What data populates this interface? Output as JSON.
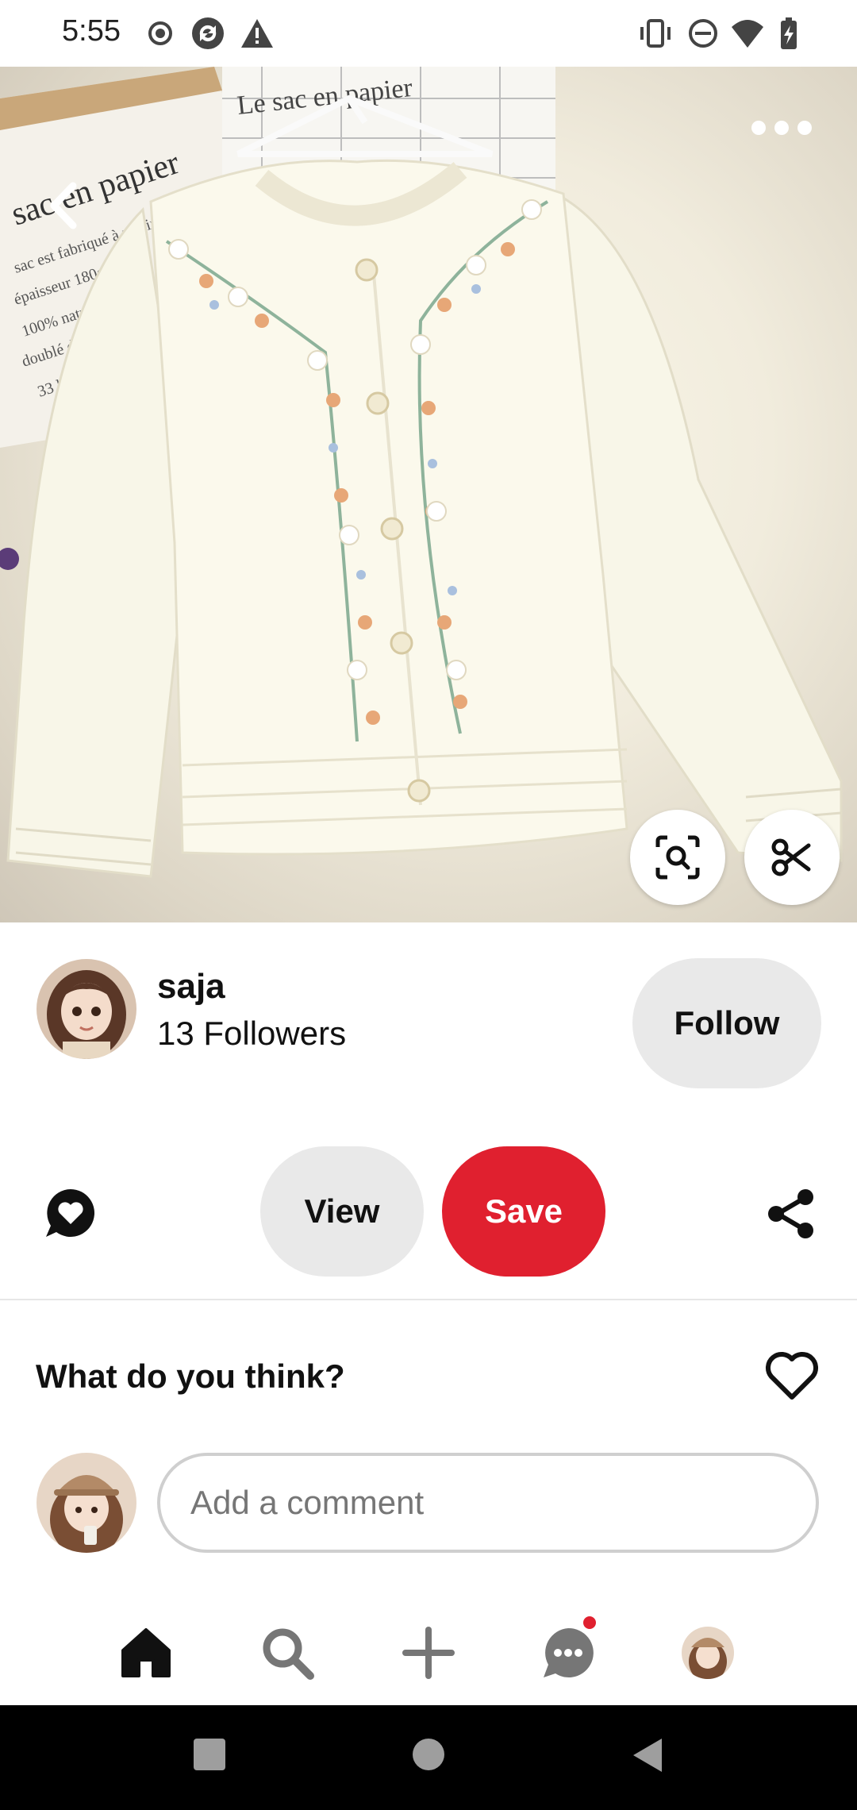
{
  "status_bar": {
    "time": "5:55",
    "left_icons": [
      "record-icon",
      "sync-icon",
      "warning-icon"
    ],
    "right_icons": [
      "vibrate-icon",
      "dnd-icon",
      "wifi-icon",
      "battery-icon"
    ]
  },
  "pin": {
    "image_alt": "cream embroidered cardigan",
    "back_icon": "back-chevron-icon",
    "more_icon": "more-dots-icon",
    "visual_search_icon": "visual-search-icon",
    "cutout_icon": "scissors-icon"
  },
  "creator": {
    "name": "saja",
    "followers": "13 Followers",
    "follow_label": "Follow"
  },
  "actions": {
    "react_icon": "comment-heart-icon",
    "view_label": "View",
    "save_label": "Save",
    "share_icon": "share-icon",
    "save_color": "#e0202f"
  },
  "comments": {
    "heading": "What do you think?",
    "like_icon": "heart-outline-icon",
    "placeholder": "Add a comment"
  },
  "bottom_nav": {
    "items": [
      "home-icon",
      "search-icon",
      "create-plus-icon",
      "messages-icon",
      "profile-avatar"
    ],
    "active": "home-icon",
    "badge_color": "#e0202f"
  },
  "system_nav": [
    "recents-square-icon",
    "home-circle-icon",
    "back-triangle-icon"
  ]
}
